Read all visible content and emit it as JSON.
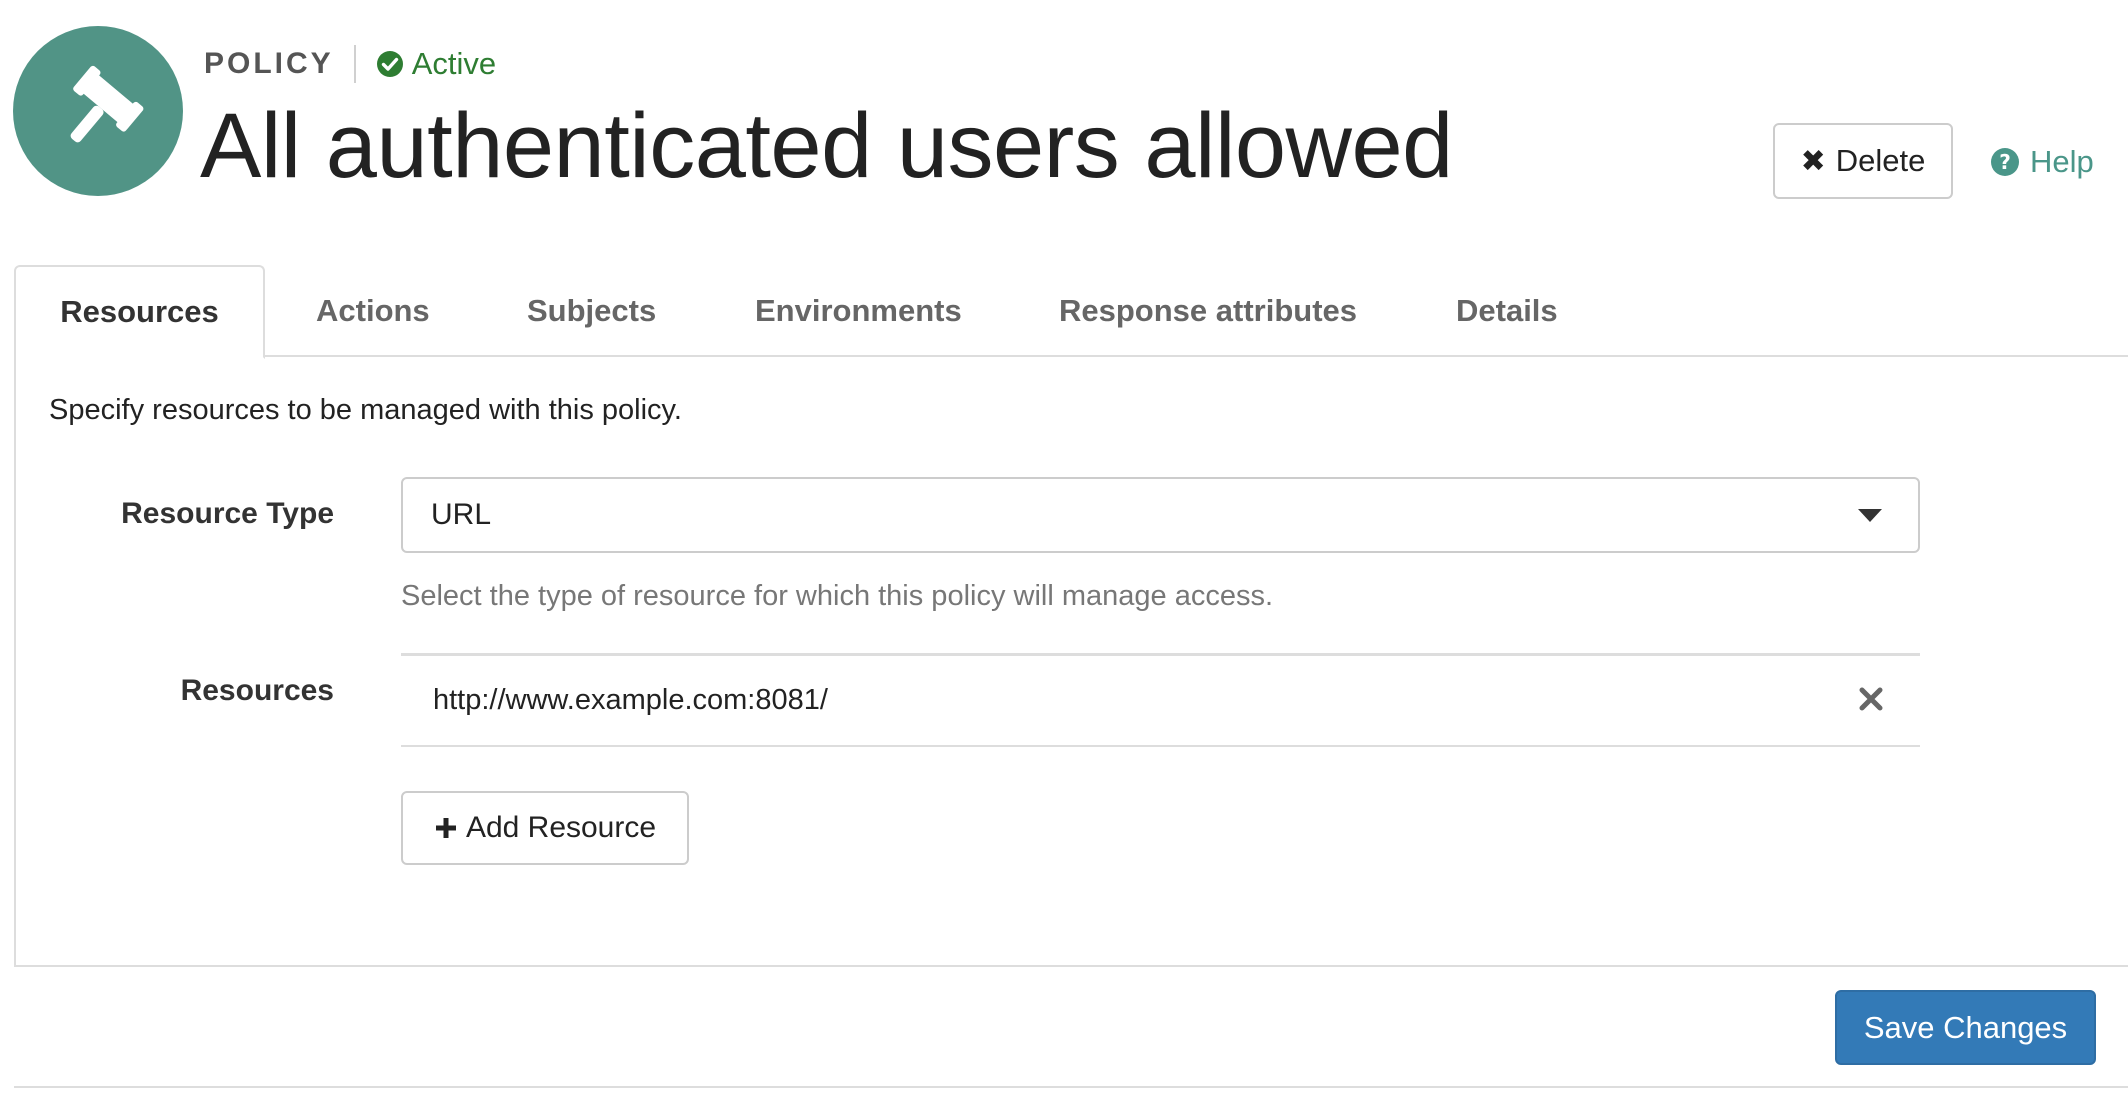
{
  "header": {
    "avatar_icon": "gavel-icon",
    "type_label": "POLICY",
    "status": {
      "label": "Active",
      "icon": "check-circle-icon",
      "color": "#2e7d32"
    },
    "title": "All authenticated users allowed",
    "delete_label": "Delete",
    "help_label": "Help",
    "accent_color": "#519486"
  },
  "tabs": [
    {
      "label": "Resources",
      "active": true
    },
    {
      "label": "Actions",
      "active": false
    },
    {
      "label": "Subjects",
      "active": false
    },
    {
      "label": "Environments",
      "active": false
    },
    {
      "label": "Response attributes",
      "active": false
    },
    {
      "label": "Details",
      "active": false
    }
  ],
  "resources_tab": {
    "intro": "Specify resources to be managed with this policy.",
    "resource_type": {
      "label": "Resource Type",
      "value": "URL",
      "help": "Select the type of resource for which this policy will manage access."
    },
    "resources": {
      "label": "Resources",
      "items": [
        "http://www.example.com:8081/"
      ],
      "add_label": "Add Resource"
    }
  },
  "footer": {
    "save_label": "Save Changes",
    "save_color": "#337ab7"
  }
}
